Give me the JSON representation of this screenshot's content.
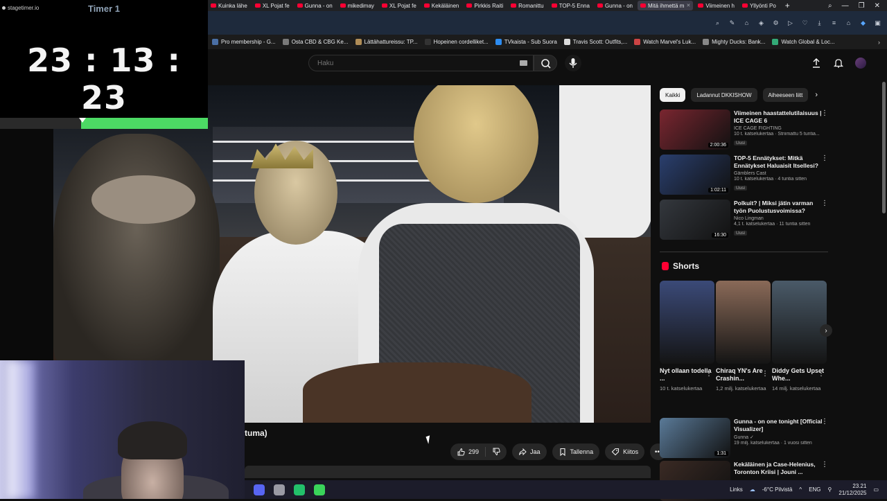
{
  "browser": {
    "tabs": [
      {
        "title": "Kuinka lähe",
        "active": false
      },
      {
        "title": "XL Pojat fe",
        "active": false
      },
      {
        "title": "Gunna - on",
        "active": false
      },
      {
        "title": "mikedimay",
        "active": false
      },
      {
        "title": "XL Pojat fe",
        "active": false
      },
      {
        "title": "Kekäläinen",
        "active": false
      },
      {
        "title": "Pirkkis Raiti",
        "active": false
      },
      {
        "title": "Romanittu",
        "active": false
      },
      {
        "title": "TOP-5 Enna",
        "active": false
      },
      {
        "title": "Gunna - on",
        "active": false
      },
      {
        "title": "Mitä ihmettä m",
        "active": true
      },
      {
        "title": "Viimeinen h",
        "active": false
      },
      {
        "title": "Yllyönti Po",
        "active": false
      }
    ],
    "new_tab": "+",
    "window_controls": [
      "⌕",
      "—",
      "❐",
      "✕"
    ],
    "bookmarks": [
      "Pro membership - G...",
      "Osta CBD & CBG Ke...",
      "Lättähattureissu: TP...",
      "Hopeinen cordelliket...",
      "TVkaista - Sub Suora",
      "Travis Scott: Outfits,...",
      "Watch Marvel's Luk...",
      "Mighty Ducks: Bank...",
      "Watch Global & Loc..."
    ],
    "bookmarks_more": "›"
  },
  "youtube": {
    "search": {
      "placeholder": "Haku"
    },
    "video": {
      "title_fragment": "tuma)",
      "likes": "299",
      "share_label": "Jaa",
      "save_label": "Tallenna",
      "thanks_label": "Kiitos",
      "more": "•••"
    },
    "chips": [
      "Kaikki",
      "Ladannut DKKISHOW",
      "Aiheeseen liitt"
    ],
    "recommended": [
      {
        "title": "Viimeinen haastattelutilaisuus | ICE CAGE 6",
        "channel": "ICE CAGE FIGHTING",
        "meta": "10 t. katselukertaa · Striimattu 5 tuntia...",
        "badge": "Uusi",
        "duration": "2:00:36",
        "thumb_color": "#7a2630"
      },
      {
        "title": "TOP-5 Ennätykset: Mitkä Ennätykset Haluaisit Itsellesi?",
        "channel": "Gämblers Cast",
        "meta": "10 t. katselukertaa · 4 tuntia sitten",
        "badge": "Uusi",
        "duration": "1:02:11",
        "thumb_color": "#2a3f6e"
      },
      {
        "title": "Polkuit? | Miksi jätin varman työn Puolustusvoimissa?",
        "channel": "Nico Lingman",
        "meta": "4,1 t. katselukertaa · 11 tuntia sitten",
        "badge": "Uusi",
        "duration": "16:30",
        "thumb_color": "#34383e"
      }
    ],
    "shorts_heading": "Shorts",
    "shorts": [
      {
        "title": "Nyt ollaan todella ...",
        "views": "10 t. katselukertaa",
        "thumb_color": "#3b4a78"
      },
      {
        "title": "Chiraq YN's Are Crashin...",
        "views": "1,2 milj. katselukertaa",
        "thumb_color": "#8a6a58"
      },
      {
        "title": "Diddy Gets Upset Whe...",
        "views": "14 milj. katselukertaa",
        "thumb_color": "#4a5a68"
      }
    ],
    "more_recommended": [
      {
        "title": "Gunna - on one tonight [Official Visualizer]",
        "channel": "Gunna ✓",
        "meta": "19 milj. katselukertaa · 1 vuosi sitten",
        "duration": "1:31",
        "thumb_color": "#5a7a98"
      },
      {
        "title": "Kekäläinen ja Case-Helenius, Toronton Kriisi | Jouni ...",
        "channel": "",
        "meta": "",
        "duration": "",
        "thumb_color": "#3a2a24"
      }
    ]
  },
  "overlay": {
    "brand": "stagetimer.io",
    "timer_name": "Timer 1",
    "timer_value": "23 : 13 : 23",
    "progress_fraction": 0.39
  },
  "taskbar": {
    "links_label": "Links",
    "weather": "-6°C  Pilvistä",
    "lang": "ENG",
    "time": "23.21",
    "date": "21/12/2025",
    "apps": [
      {
        "name": "discord",
        "color": "#5865f2"
      },
      {
        "name": "app",
        "color": "#9a9aa4"
      },
      {
        "name": "app",
        "color": "#23c06a"
      },
      {
        "name": "app",
        "color": "#3ad45a"
      }
    ]
  }
}
